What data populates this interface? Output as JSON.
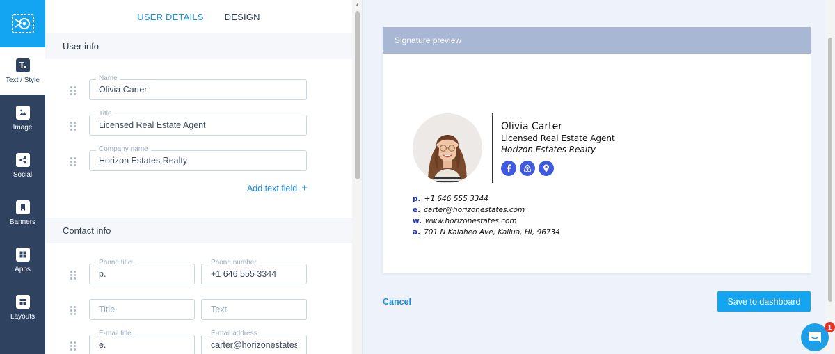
{
  "tabs": [
    {
      "label": "USER DETAILS",
      "active": true
    },
    {
      "label": "DESIGN",
      "active": false
    }
  ],
  "sidebar": {
    "items": [
      {
        "label": "Text / Style",
        "icon": "text-style-icon"
      },
      {
        "label": "Image",
        "icon": "image-icon"
      },
      {
        "label": "Social",
        "icon": "share-icon"
      },
      {
        "label": "Banners",
        "icon": "bookmark-icon"
      },
      {
        "label": "Apps",
        "icon": "grid-icon"
      },
      {
        "label": "Layouts",
        "icon": "layout-icon"
      }
    ]
  },
  "user_info": {
    "heading": "User info",
    "fields": [
      {
        "label": "Name",
        "value": "Olivia Carter"
      },
      {
        "label": "Title",
        "value": "Licensed Real Estate Agent"
      },
      {
        "label": "Company name",
        "value": "Horizon Estates Realty"
      }
    ],
    "add_field": "Add text field",
    "add_plus": "+"
  },
  "contact_info": {
    "heading": "Contact info",
    "phone_title_label": "Phone title",
    "phone_title_value": "p.",
    "phone_number_label": "Phone number",
    "phone_number_value": "+1 646 555 3344",
    "title_placeholder": "Title",
    "text_placeholder": "Text",
    "email_title_label": "E-mail title",
    "email_title_value": "e.",
    "email_address_label": "E-mail address",
    "email_address_value": "carter@horizonestates.com"
  },
  "preview": {
    "heading": "Signature preview",
    "name": "Olivia Carter",
    "title": "Licensed Real Estate Agent",
    "company": "Horizon Estates Realty",
    "socials": [
      "facebook-icon",
      "airbnb-icon",
      "location-pin-icon"
    ],
    "contacts": [
      {
        "key": "p.",
        "value": "+1 646 555 3344"
      },
      {
        "key": "e.",
        "value": "carter@horizonestates.com"
      },
      {
        "key": "w.",
        "value": "www.horizonestates.com"
      },
      {
        "key": "a.",
        "value": "701 N Kalaheo Ave, Kailua, HI, 96734"
      }
    ]
  },
  "actions": {
    "cancel": "Cancel",
    "save": "Save to dashboard"
  },
  "chat": {
    "badge": "1"
  },
  "colors": {
    "accent": "#13a4f2",
    "rail": "#2f4360",
    "link": "#1a8fe3",
    "social": "#3f5ae0",
    "contact_key": "#1b2fb8"
  }
}
